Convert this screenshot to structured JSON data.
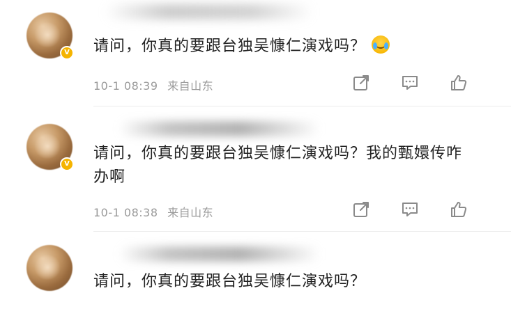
{
  "comments": [
    {
      "text": "请问，你真的要跟台独吴慷仁演戏吗？",
      "timestamp": "10-1 08:39",
      "location": "来自山东",
      "has_emoji": true,
      "emoji": "crying-face"
    },
    {
      "text": "请问，你真的要跟台独吴慷仁演戏吗？我的甄嬛传咋办啊",
      "timestamp": "10-1 08:38",
      "location": "来自山东",
      "has_emoji": false
    },
    {
      "text": "请问，你真的要跟台独吴慷仁演戏吗？",
      "timestamp": "",
      "location": "",
      "has_emoji": false
    }
  ],
  "icons": {
    "share": "share-icon",
    "reply": "comment-icon",
    "like": "thumbs-up-icon",
    "verified": "verified-badge-icon"
  },
  "colors": {
    "text": "#222222",
    "meta": "#9a9a9a",
    "icon": "#8a8a8a",
    "badge": "#f5b400"
  }
}
